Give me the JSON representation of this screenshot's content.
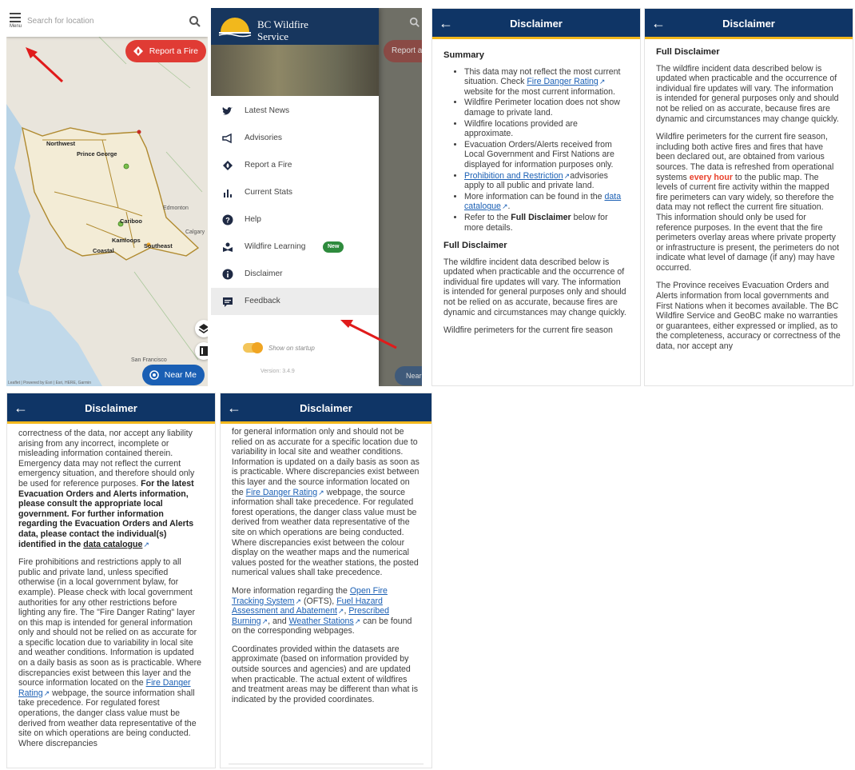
{
  "map_screen": {
    "menu_label": "Menu",
    "search_placeholder": "Search for location",
    "report_button": "Report a Fire",
    "near_me_button": "Near Me",
    "icons": [
      "menu-icon",
      "search-icon",
      "fire-icon",
      "layers-icon",
      "book-icon",
      "crosshair-icon"
    ],
    "regions": [
      "Northwest",
      "Prince George",
      "Cariboo",
      "Kamloops",
      "Southeast",
      "Coastal"
    ],
    "places": [
      "Edmonton",
      "Calgary",
      "San Francisco"
    ],
    "attribution": "Leaflet | Powered by Esri | Esri, HERE, Garmin"
  },
  "drawer": {
    "brand_line1": "BC Wildfire",
    "brand_line2": "Service",
    "items": [
      {
        "label": "Latest News",
        "icon": "twitter-icon"
      },
      {
        "label": "Advisories",
        "icon": "megaphone-icon"
      },
      {
        "label": "Report a Fire",
        "icon": "fire-icon"
      },
      {
        "label": "Current Stats",
        "icon": "bar-chart-icon"
      },
      {
        "label": "Help",
        "icon": "help-icon"
      },
      {
        "label": "Wildfire Learning",
        "icon": "learning-icon",
        "badge": "New"
      },
      {
        "label": "Disclaimer",
        "icon": "info-icon"
      },
      {
        "label": "Feedback",
        "icon": "feedback-icon"
      }
    ],
    "toggle_label": "Show on startup",
    "version": "Version: 3.4.9",
    "search_icon": "search-icon",
    "behind_report": "Report a Fire",
    "behind_near": "Near Me"
  },
  "header": {
    "title": "Disclaimer",
    "back_icon": "arrow-left-icon"
  },
  "disc1": {
    "summary": "Summary",
    "b1_a": "This data may not reflect the most current situation. Check ",
    "b1_link": "Fire Danger Rating",
    "b1_b": " website for the most current information.",
    "b2": "Wildfire Perimeter location does not show damage to private land.",
    "b3": "Wildfire locations provided are approximate.",
    "b4": "Evacuation Orders/Alerts received from Local Government and First Nations are displayed for information purposes only.",
    "b5_link": "Prohibition and Restriction",
    "b5_b": "advisories apply to all public and private land.",
    "b6_a": "More information can be found in the ",
    "b6_link": "data catalogue",
    "b7_a": "Refer to the ",
    "b7_bold": "Full Disclaimer",
    "b7_b": " below for more details.",
    "full": "Full Disclaimer",
    "p1": "The wildfire incident data described below is updated when practicable and the occurrence of individual fire updates will vary. The information is intended for general purposes only and should not be relied on as accurate, because fires are dynamic and circumstances may change quickly.",
    "p2": "Wildfire perimeters for the current fire season"
  },
  "disc2": {
    "full": "Full Disclaimer",
    "p1": "The wildfire incident data described below is updated when practicable and the occurrence of individual fire updates will vary. The information is intended for general purposes only and should not be relied on as accurate, because fires are dynamic and circumstances may change quickly.",
    "p2_a": "Wildfire perimeters for the current fire season, including both active fires and fires that have been declared out, are obtained from various sources. The data is refreshed from operational systems ",
    "p2_red": "every hour",
    "p2_b": " to the public map. The levels of current fire activity within the mapped fire perimeters can vary widely, so therefore the data may not reflect the current fire situation. This information should only be used for reference purposes. In the event that the fire perimeters overlay areas where private property or infrastructure is present, the perimeters do not indicate what level of damage (if any) may have occurred.",
    "p3": "The Province receives Evacuation Orders and Alerts information from local governments and First Nations when it becomes available. The BC Wildfire Service and GeoBC make no warranties or guarantees, either expressed or implied, as to the completeness, accuracy or correctness of the data, nor accept any"
  },
  "disc3": {
    "p1_a": "correctness of the data, nor accept any liability arising from any incorrect, incomplete or misleading information contained therein. Emergency data may not reflect the current emergency situation, and therefore should only be used for reference purposes. ",
    "p1_bold": "For the latest Evacuation Orders and Alerts information, please consult the appropriate local government. For further information regarding the Evacuation Orders and Alerts data, please contact the individual(s) identified in the ",
    "p1_link": "data catalogue",
    "p2_a": "Fire prohibitions and restrictions apply to all public and private land, unless specified otherwise (in a local government bylaw, for example). Please check with local government authorities for any other restrictions before lighting any fire. The \"Fire Danger Rating\" layer on this map is intended for general information only and should not be relied on as accurate for a specific location due to variability in local site and weather conditions. Information is updated on a daily basis as soon as is practicable. Where discrepancies exist between this layer and the source information located on the ",
    "p2_link": "Fire Danger Rating",
    "p2_b": " webpage, the source information shall take precedence. For regulated forest operations, the danger class value must be derived from weather data representative of the site on which operations are being conducted. Where discrepancies"
  },
  "disc4": {
    "p1_a": "for general information only and should not be relied on as accurate for a specific location due to variability in local site and weather conditions. Information is updated on a daily basis as soon as is practicable. Where discrepancies exist between this layer and the source information located on the ",
    "p1_link": "Fire Danger Rating",
    "p1_b": " webpage, the source information shall take precedence. For regulated forest operations, the danger class value must be derived from weather data representative of the site on which operations are being conducted. Where discrepancies exist between the colour display on the weather maps and the numerical values posted for the weather stations, the posted numerical values shall take precedence.",
    "p2_a": "More information regarding the ",
    "p2_l1": "Open Fire Tracking System",
    "p2_b": " (OFTS), ",
    "p2_l2": "Fuel Hazard Assessment and Abatement",
    "p2_c": ", ",
    "p2_l3": "Prescribed Burning",
    "p2_d": ", and ",
    "p2_l4": "Weather Stations",
    "p2_e": " can be found on the corresponding webpages.",
    "p3": "Coordinates provided within the datasets are approximate (based on information provided by outside sources and agencies) and are updated when practicable. The actual extent of wildfires and treatment areas may be different than what is indicated by the provided coordinates."
  },
  "colors": {
    "header": "#0f3566",
    "accent": "#f2b81c",
    "report": "#e03b34",
    "near_me": "#1a5fb4",
    "link": "#1a5fb4",
    "highlight": "#e8412c",
    "arrow": "#e01b1b"
  }
}
